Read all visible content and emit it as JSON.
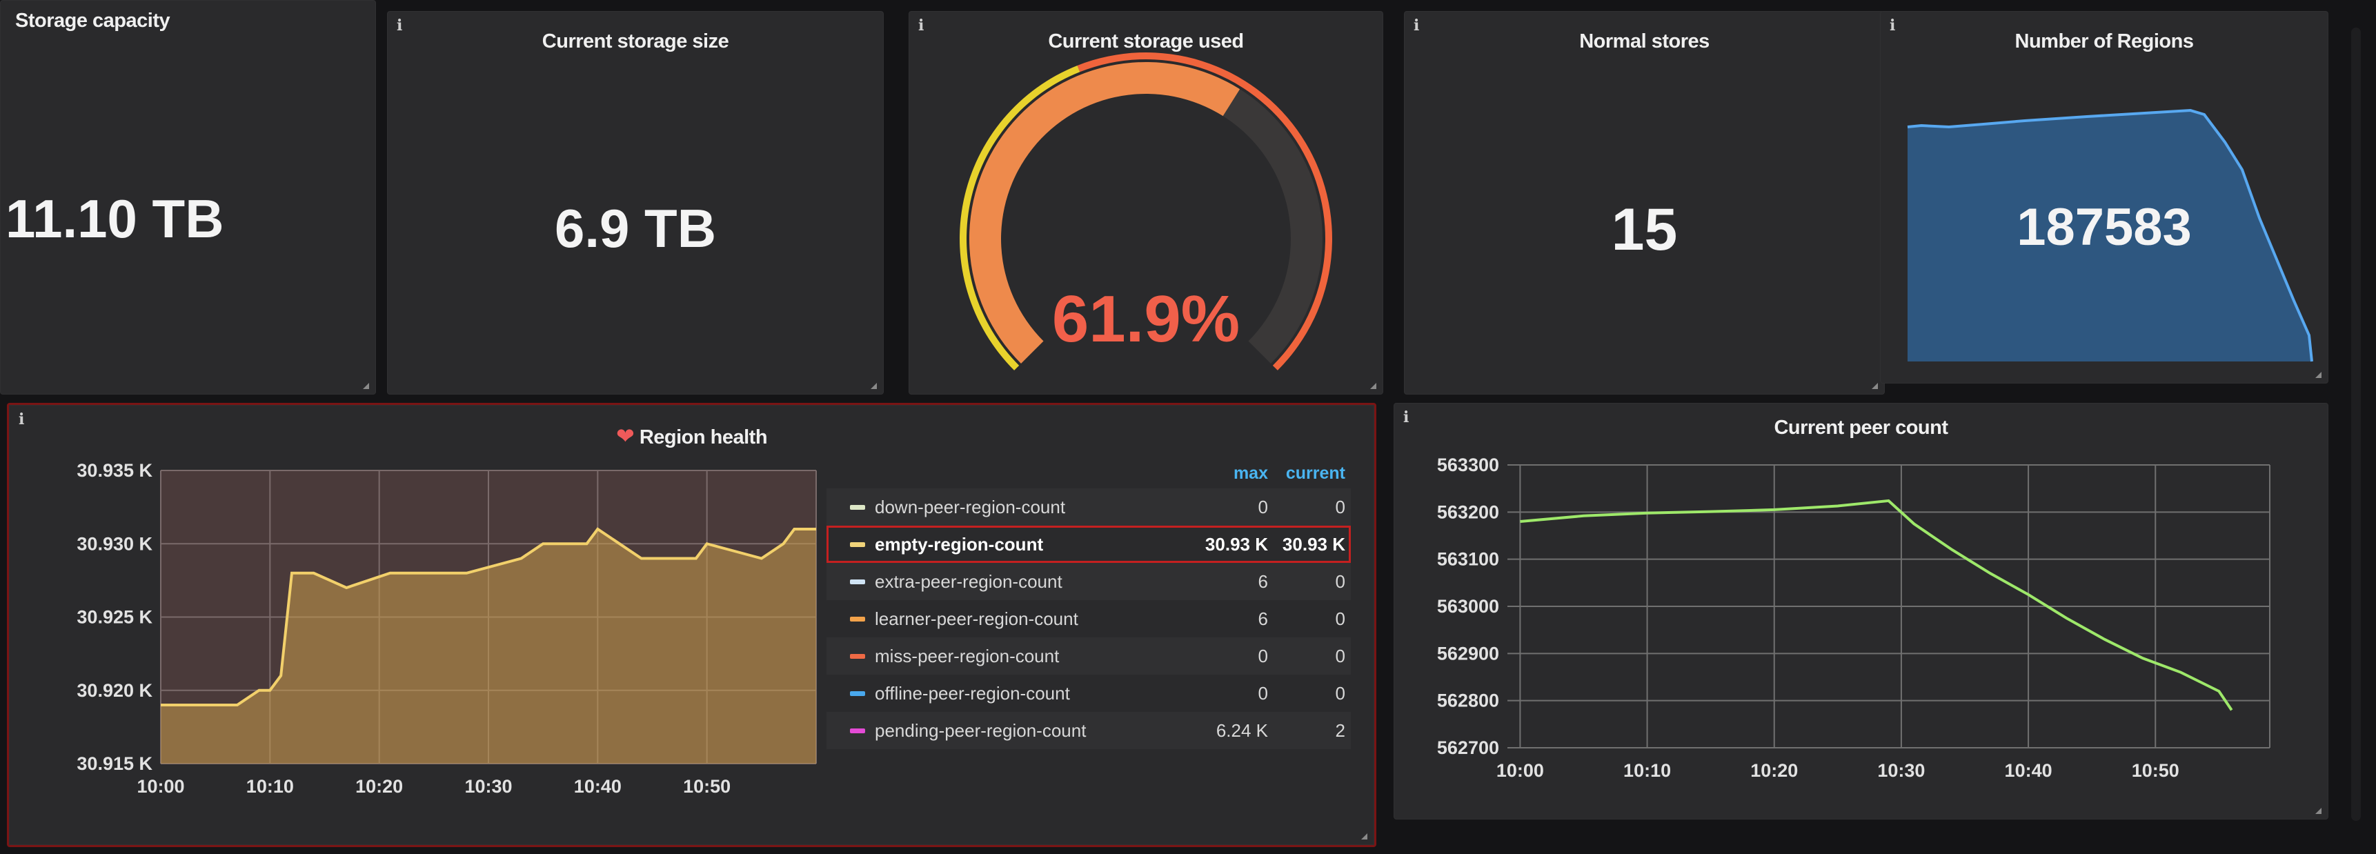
{
  "stats": {
    "capacity": {
      "title": "Storage capacity",
      "value": "11.10 TB"
    },
    "current_size": {
      "title": "Current storage size",
      "value": "6.9 TB"
    },
    "used": {
      "title": "Current storage used",
      "value": "61.9%",
      "percent": 61.9
    },
    "normal_stores": {
      "title": "Normal stores",
      "value": "15"
    },
    "regions": {
      "title": "Number of Regions",
      "value": "187583"
    }
  },
  "info_glyph": "i",
  "region_health": {
    "title": "Region health",
    "legend_headers": {
      "max": "max",
      "current": "current"
    },
    "legend": [
      {
        "name": "down-peer-region-count",
        "max": "0",
        "current": "0",
        "color": "#dde7c6"
      },
      {
        "name": "empty-region-count",
        "max": "30.93 K",
        "current": "30.93 K",
        "color": "#f0d37a"
      },
      {
        "name": "extra-peer-region-count",
        "max": "6",
        "current": "0",
        "color": "#cfe3f4"
      },
      {
        "name": "learner-peer-region-count",
        "max": "6",
        "current": "0",
        "color": "#f2a24a"
      },
      {
        "name": "miss-peer-region-count",
        "max": "0",
        "current": "0",
        "color": "#ef6a45"
      },
      {
        "name": "offline-peer-region-count",
        "max": "0",
        "current": "0",
        "color": "#49a8ee"
      },
      {
        "name": "pending-peer-region-count",
        "max": "6.24 K",
        "current": "2",
        "color": "#e44bd6"
      }
    ]
  },
  "peer_count": {
    "title": "Current peer count"
  },
  "chart_data": [
    {
      "type": "area",
      "title": "Region health",
      "x_ticks": [
        "10:00",
        "10:10",
        "10:20",
        "10:30",
        "10:40",
        "10:50"
      ],
      "y_ticks": [
        "30.935 K",
        "30.930 K",
        "30.925 K",
        "30.920 K",
        "30.915 K"
      ],
      "ylim": [
        30.915,
        30.935
      ],
      "grid": true,
      "series": [
        {
          "name": "empty-region-count",
          "x": [
            0,
            3,
            7,
            9,
            10,
            11,
            12,
            14,
            17,
            21,
            26,
            28,
            33,
            35,
            36,
            39,
            40,
            44,
            46,
            49,
            50,
            55,
            57,
            58,
            59,
            60
          ],
          "y": [
            30.919,
            30.919,
            30.919,
            30.92,
            30.92,
            30.921,
            30.928,
            30.928,
            30.927,
            30.928,
            30.928,
            30.928,
            30.929,
            30.93,
            30.93,
            30.93,
            30.931,
            30.929,
            30.929,
            30.929,
            30.93,
            30.929,
            30.93,
            30.931,
            30.931,
            30.931
          ]
        }
      ]
    },
    {
      "type": "line",
      "title": "Current peer count",
      "x_ticks": [
        "10:00",
        "10:10",
        "10:20",
        "10:30",
        "10:40",
        "10:50"
      ],
      "y_ticks": [
        "563300",
        "563200",
        "563100",
        "563000",
        "562900",
        "562800",
        "562700"
      ],
      "ylim": [
        562700,
        563300
      ],
      "grid": true,
      "series": [
        {
          "name": "peer count",
          "x": [
            0,
            5,
            10,
            15,
            20,
            25,
            29,
            31,
            34,
            37,
            40,
            43,
            46,
            49,
            52,
            55,
            56
          ],
          "y": [
            563180,
            563192,
            563198,
            563201,
            563205,
            563213,
            563224,
            563175,
            563120,
            563070,
            563025,
            562975,
            562930,
            562890,
            562860,
            562820,
            562780
          ]
        }
      ]
    }
  ]
}
